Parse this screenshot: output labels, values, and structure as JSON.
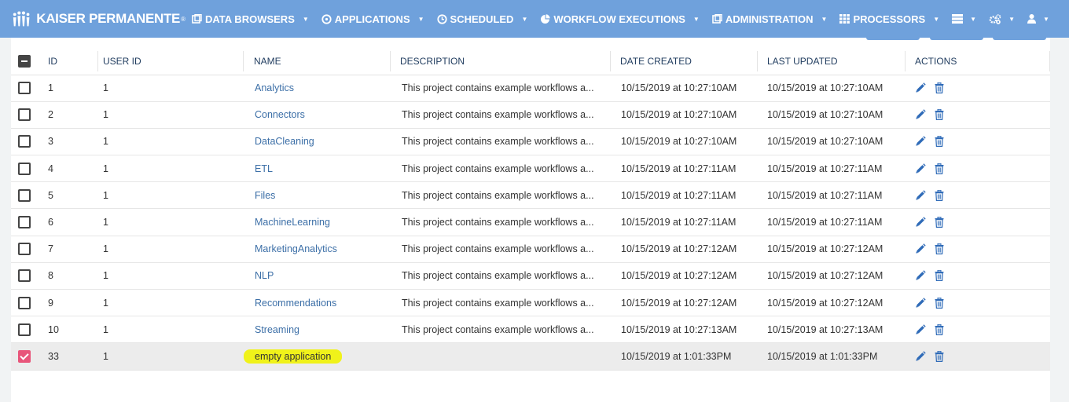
{
  "brand": {
    "name": "KAISER PERMANENTE",
    "reg": "®",
    "logo_icon": "kaiser-people-icon"
  },
  "nav": [
    {
      "label": "DATA BROWSERS",
      "icon": "data-browser-icon"
    },
    {
      "label": "APPLICATIONS",
      "icon": "applications-icon"
    },
    {
      "label": "SCHEDULED",
      "icon": "clock-icon"
    },
    {
      "label": "WORKFLOW EXECUTIONS",
      "icon": "pie-chart-icon"
    },
    {
      "label": "ADMINISTRATION",
      "icon": "admin-icon"
    },
    {
      "label": "PROCESSORS",
      "icon": "grid-icon"
    }
  ],
  "nav_right": [
    {
      "icon": "server-icon"
    },
    {
      "icon": "cogs-icon"
    },
    {
      "icon": "user-icon"
    }
  ],
  "table": {
    "headers": {
      "id": "ID",
      "user_id": "USER ID",
      "name": "NAME",
      "description": "DESCRIPTION",
      "created": "DATE CREATED",
      "updated": "LAST UPDATED",
      "actions": "ACTIONS"
    },
    "rows": [
      {
        "id": "1",
        "user_id": "1",
        "name": "Analytics",
        "description": "This project contains example workflows a...",
        "created": "10/15/2019 at 10:27:10AM",
        "updated": "10/15/2019 at 10:27:10AM",
        "checked": false
      },
      {
        "id": "2",
        "user_id": "1",
        "name": "Connectors",
        "description": "This project contains example workflows a...",
        "created": "10/15/2019 at 10:27:10AM",
        "updated": "10/15/2019 at 10:27:10AM",
        "checked": false
      },
      {
        "id": "3",
        "user_id": "1",
        "name": "DataCleaning",
        "description": "This project contains example workflows a...",
        "created": "10/15/2019 at 10:27:10AM",
        "updated": "10/15/2019 at 10:27:10AM",
        "checked": false
      },
      {
        "id": "4",
        "user_id": "1",
        "name": "ETL",
        "description": "This project contains example workflows a...",
        "created": "10/15/2019 at 10:27:11AM",
        "updated": "10/15/2019 at 10:27:11AM",
        "checked": false
      },
      {
        "id": "5",
        "user_id": "1",
        "name": "Files",
        "description": "This project contains example workflows a...",
        "created": "10/15/2019 at 10:27:11AM",
        "updated": "10/15/2019 at 10:27:11AM",
        "checked": false
      },
      {
        "id": "6",
        "user_id": "1",
        "name": "MachineLearning",
        "description": "This project contains example workflows a...",
        "created": "10/15/2019 at 10:27:11AM",
        "updated": "10/15/2019 at 10:27:11AM",
        "checked": false
      },
      {
        "id": "7",
        "user_id": "1",
        "name": "MarketingAnalytics",
        "description": "This project contains example workflows a...",
        "created": "10/15/2019 at 10:27:12AM",
        "updated": "10/15/2019 at 10:27:12AM",
        "checked": false
      },
      {
        "id": "8",
        "user_id": "1",
        "name": "NLP",
        "description": "This project contains example workflows a...",
        "created": "10/15/2019 at 10:27:12AM",
        "updated": "10/15/2019 at 10:27:12AM",
        "checked": false
      },
      {
        "id": "9",
        "user_id": "1",
        "name": "Recommendations",
        "description": "This project contains example workflows a...",
        "created": "10/15/2019 at 10:27:12AM",
        "updated": "10/15/2019 at 10:27:12AM",
        "checked": false
      },
      {
        "id": "10",
        "user_id": "1",
        "name": "Streaming",
        "description": "This project contains example workflows a...",
        "created": "10/15/2019 at 10:27:13AM",
        "updated": "10/15/2019 at 10:27:13AM",
        "checked": false
      },
      {
        "id": "33",
        "user_id": "1",
        "name": "empty application",
        "description": "",
        "created": "10/15/2019 at 1:01:33PM",
        "updated": "10/15/2019 at 1:01:33PM",
        "checked": true,
        "highlighted": true
      }
    ]
  },
  "colors": {
    "nav_bg": "#6fa1dc",
    "link": "#3c6fa7",
    "checked": "#e8557a",
    "highlight": "#f0f21a",
    "action_icon": "#2f6bb8"
  }
}
